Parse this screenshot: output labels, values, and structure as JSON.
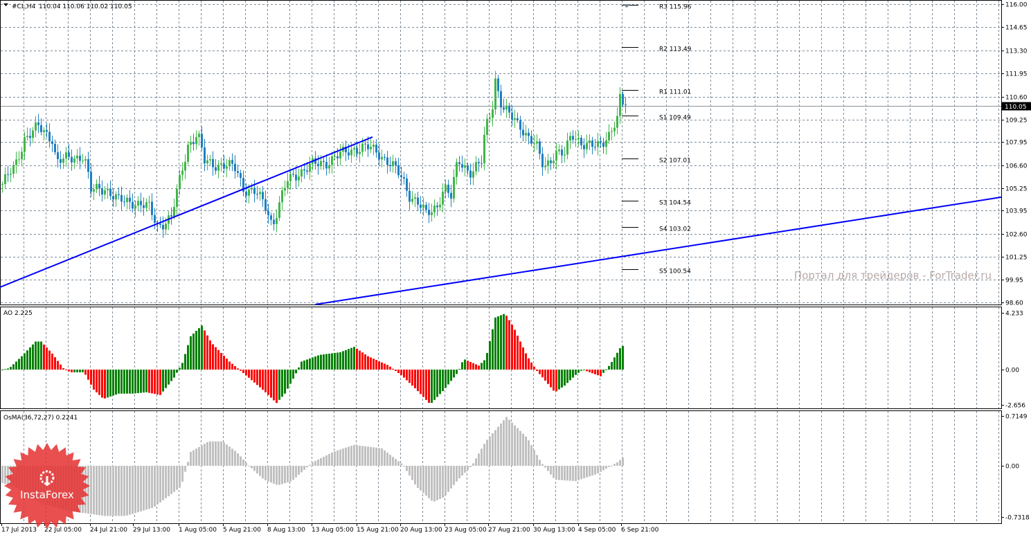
{
  "chart_data": {
    "type": "candlestick",
    "title": "#CL,H4",
    "ohlc_header": "110.04 110.06 110.02 110.05",
    "current_price": 110.05,
    "current_price_label": "110.05",
    "price_ylim": [
      98.6,
      116.0
    ],
    "price_ticks": [
      "116.00",
      "114.65",
      "113.30",
      "111.95",
      "110.60",
      "109.25",
      "107.95",
      "106.60",
      "105.25",
      "103.95",
      "102.60",
      "101.25",
      "99.95",
      "98.60"
    ],
    "x_ticks": [
      {
        "label": "17 Jul 2013",
        "bar": 0
      },
      {
        "label": "22 Jul 05:00",
        "bar": 15.5
      },
      {
        "label": "24 Jul 21:00",
        "bar": 32
      },
      {
        "label": "29 Jul 13:00",
        "bar": 47.5
      },
      {
        "label": "1 Aug 05:00",
        "bar": 64
      },
      {
        "label": "5 Aug 21:00",
        "bar": 80
      },
      {
        "label": "8 Aug 13:00",
        "bar": 96
      },
      {
        "label": "13 Aug 05:00",
        "bar": 112
      },
      {
        "label": "15 Aug 21:00",
        "bar": 128.25
      },
      {
        "label": "20 Aug 13:00",
        "bar": 144
      },
      {
        "label": "23 Aug 05:00",
        "bar": 160
      },
      {
        "label": "27 Aug 21:00",
        "bar": 175.75
      },
      {
        "label": "30 Aug 13:00",
        "bar": 192
      },
      {
        "label": "4 Sep 05:00",
        "bar": 208.25
      },
      {
        "label": "6 Sep 21:00",
        "bar": 223.75
      }
    ],
    "close_keypoints": [
      [
        0,
        105.5
      ],
      [
        4.5,
        106.5
      ],
      [
        8,
        108.2
      ],
      [
        13,
        108.8
      ],
      [
        18,
        108.2
      ],
      [
        19.5,
        106.8
      ],
      [
        24.5,
        107.0
      ],
      [
        29.5,
        107.2
      ],
      [
        32,
        105.1
      ],
      [
        37,
        105.3
      ],
      [
        42,
        104.5
      ],
      [
        47,
        104.5
      ],
      [
        53,
        104.1
      ],
      [
        56,
        103.1
      ],
      [
        61,
        103.5
      ],
      [
        64.5,
        106.1
      ],
      [
        67,
        107.8
      ],
      [
        70.5,
        108.4
      ],
      [
        73,
        106.8
      ],
      [
        79.5,
        106.6
      ],
      [
        84.5,
        106.4
      ],
      [
        87,
        105.3
      ],
      [
        92,
        104.9
      ],
      [
        95.5,
        104.1
      ],
      [
        97.5,
        103.1
      ],
      [
        99.5,
        104.1
      ],
      [
        103,
        105.7
      ],
      [
        107,
        106.2
      ],
      [
        112,
        106.6
      ],
      [
        117,
        106.8
      ],
      [
        122,
        107.2
      ],
      [
        127,
        107.6
      ],
      [
        132,
        107.6
      ],
      [
        135.5,
        107.4
      ],
      [
        140.5,
        106.6
      ],
      [
        144.5,
        105.8
      ],
      [
        147,
        104.9
      ],
      [
        150.5,
        104.3
      ],
      [
        153,
        103.7
      ],
      [
        157,
        104.3
      ],
      [
        159.5,
        105.3
      ],
      [
        162,
        104.7
      ],
      [
        164.5,
        107.0
      ],
      [
        169.5,
        106.1
      ],
      [
        173,
        106.8
      ],
      [
        174.5,
        108.9
      ],
      [
        177,
        110.2
      ],
      [
        178,
        111.6
      ],
      [
        180.5,
        109.8
      ],
      [
        184.5,
        109.4
      ],
      [
        187,
        109.0
      ],
      [
        189.5,
        108.2
      ],
      [
        193,
        107.6
      ],
      [
        195.5,
        106.6
      ],
      [
        199.5,
        107.2
      ],
      [
        203,
        107.2
      ],
      [
        205.5,
        108.6
      ],
      [
        210.5,
        107.6
      ],
      [
        214.5,
        107.8
      ],
      [
        219.5,
        108.4
      ],
      [
        222,
        109.2
      ],
      [
        223,
        110.4
      ],
      [
        225.5,
        110.05
      ]
    ],
    "bars": 226,
    "pivots": [
      {
        "label": "R3 115.96",
        "value": 115.96
      },
      {
        "label": "R2 113.49",
        "value": 113.49
      },
      {
        "label": "R1 111.01",
        "value": 111.01
      },
      {
        "label": "S1 109.49",
        "value": 109.49
      },
      {
        "label": "S2 107.01",
        "value": 107.01
      },
      {
        "label": "S3 104.54",
        "value": 104.54
      },
      {
        "label": "S4 103.02",
        "value": 103.02
      },
      {
        "label": "S5 100.54",
        "value": 100.54
      }
    ],
    "trendlines": [
      {
        "from": [
          -0.5,
          99.49
        ],
        "to": [
          134,
          108.25
        ]
      },
      {
        "from": [
          113.25,
          98.48
        ],
        "to": [
          361,
          104.74
        ]
      }
    ],
    "ao": {
      "label": "AO 2.225",
      "ticks": [
        "4.233",
        "0.00",
        "-2.656"
      ],
      "ylim": [
        -2.656,
        4.233
      ],
      "keypoints": [
        [
          0,
          0
        ],
        [
          2.5,
          0.1
        ],
        [
          7,
          1
        ],
        [
          12,
          2.1
        ],
        [
          14,
          2.1
        ],
        [
          18,
          1.2
        ],
        [
          22,
          0.1
        ],
        [
          24.5,
          -0.2
        ],
        [
          29.5,
          -0.2
        ],
        [
          33,
          -1.5
        ],
        [
          36.5,
          -2.2
        ],
        [
          42,
          -1.8
        ],
        [
          47,
          -1.8
        ],
        [
          52,
          -1.7
        ],
        [
          57,
          -1.9
        ],
        [
          62,
          -0.6
        ],
        [
          65,
          0.5
        ],
        [
          68,
          2.5
        ],
        [
          72,
          3.3
        ],
        [
          75.5,
          2.0
        ],
        [
          82,
          0.6
        ],
        [
          85.5,
          0
        ],
        [
          89.5,
          -0.7
        ],
        [
          94.5,
          -1.6
        ],
        [
          99,
          -2.5
        ],
        [
          102,
          -1.8
        ],
        [
          105.5,
          -0.5
        ],
        [
          108,
          0.6
        ],
        [
          114.5,
          1.1
        ],
        [
          122,
          1.3
        ],
        [
          127,
          1.7
        ],
        [
          132,
          1.0
        ],
        [
          139.5,
          0.3
        ],
        [
          144.5,
          -0.5
        ],
        [
          149.5,
          -1.5
        ],
        [
          154.5,
          -2.6
        ],
        [
          159.5,
          -1.5
        ],
        [
          164.5,
          -0.2
        ],
        [
          166.5,
          0.8
        ],
        [
          172,
          0.3
        ],
        [
          174.5,
          0.8
        ],
        [
          178,
          3.9
        ],
        [
          181.5,
          4.2
        ],
        [
          184.5,
          3.2
        ],
        [
          189.5,
          1.0
        ],
        [
          193,
          -0.1
        ],
        [
          195.5,
          -0.7
        ],
        [
          199.5,
          -1.7
        ],
        [
          203,
          -1.2
        ],
        [
          207,
          -0.4
        ],
        [
          209.5,
          0
        ],
        [
          212,
          -0.2
        ],
        [
          216,
          -0.5
        ],
        [
          219.5,
          0.4
        ],
        [
          223,
          1.6
        ],
        [
          227,
          2.3
        ]
      ]
    },
    "osma": {
      "label": "OsMA(36,72,27) 0.2241",
      "ticks": [
        "0.7149",
        "0.00",
        "-0.7318"
      ],
      "ylim": [
        -0.7318,
        0.7149
      ],
      "keypoints": [
        [
          0,
          -0.25
        ],
        [
          4.5,
          -0.3
        ],
        [
          14.5,
          -0.55
        ],
        [
          24.5,
          -0.65
        ],
        [
          37,
          -0.72
        ],
        [
          44.5,
          -0.72
        ],
        [
          54.5,
          -0.6
        ],
        [
          64.5,
          -0.3
        ],
        [
          68,
          0.2
        ],
        [
          74.5,
          0.35
        ],
        [
          79.5,
          0.35
        ],
        [
          84.5,
          0.2
        ],
        [
          89.5,
          -0.02
        ],
        [
          94.5,
          -0.2
        ],
        [
          99.5,
          -0.28
        ],
        [
          104.5,
          -0.22
        ],
        [
          112,
          0.05
        ],
        [
          119.5,
          0.2
        ],
        [
          127,
          0.3
        ],
        [
          137,
          0.25
        ],
        [
          144.5,
          0.02
        ],
        [
          149.5,
          -0.3
        ],
        [
          155.5,
          -0.52
        ],
        [
          159.5,
          -0.45
        ],
        [
          164.5,
          -0.2
        ],
        [
          169.5,
          0
        ],
        [
          174.5,
          0.35
        ],
        [
          182,
          0.7
        ],
        [
          189.5,
          0.4
        ],
        [
          194.5,
          0.05
        ],
        [
          199.5,
          -0.2
        ],
        [
          207,
          -0.22
        ],
        [
          214.5,
          -0.12
        ],
        [
          222,
          0.05
        ],
        [
          227,
          0.22
        ]
      ]
    },
    "colors": {
      "up": "#41b649",
      "down": "#1f7fc0",
      "ao_up": "#008000",
      "ao_down": "#ff0000",
      "osma": "#c0c0c0",
      "trend": "#0000ff",
      "grid": "#7a8a9a"
    }
  },
  "watermark": "Портал для трейдеров - ForTrader.ru",
  "logo_text": "InstaForex"
}
